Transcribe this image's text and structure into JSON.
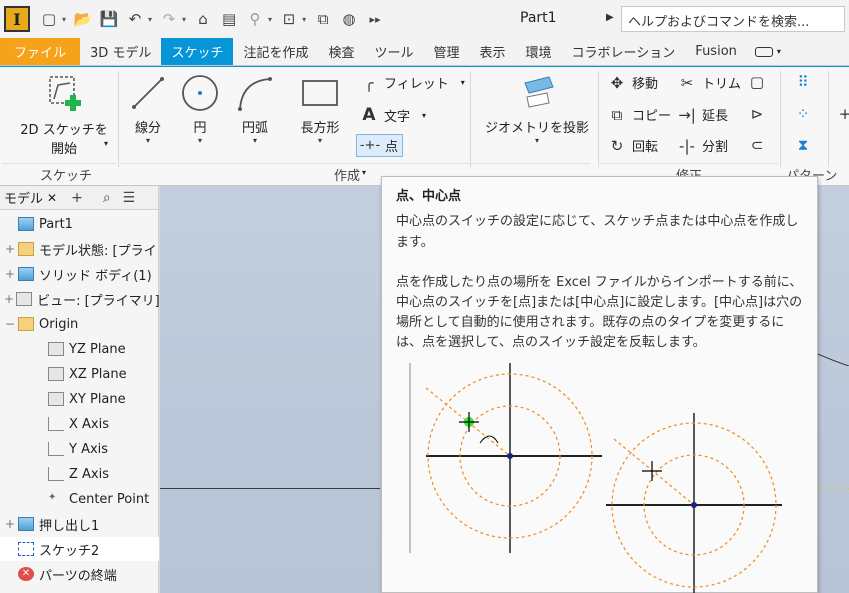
{
  "app": {
    "logo_letter": "I",
    "document_title": "Part1"
  },
  "help_search": {
    "placeholder": "ヘルプおよびコマンドを検索..."
  },
  "tabs": [
    {
      "label": "ファイル",
      "state": "file"
    },
    {
      "label": "3D モデル",
      "state": "normal"
    },
    {
      "label": "スケッチ",
      "state": "active"
    },
    {
      "label": "注記を作成",
      "state": "normal"
    },
    {
      "label": "検査",
      "state": "normal"
    },
    {
      "label": "ツール",
      "state": "normal"
    },
    {
      "label": "管理",
      "state": "normal"
    },
    {
      "label": "表示",
      "state": "normal"
    },
    {
      "label": "環境",
      "state": "normal"
    },
    {
      "label": "コラボレーション",
      "state": "normal"
    },
    {
      "label": "Fusion",
      "state": "normal"
    }
  ],
  "ribbon": {
    "start_sketch": {
      "line1": "2D スケッチを",
      "line2": "開始"
    },
    "line_label": "線分",
    "circle_label": "円",
    "arc_label": "円弧",
    "rect_label": "長方形",
    "fillet_label": "フィレット",
    "text_label": "文字",
    "point_label": "点",
    "project_geometry_label": "ジオメトリを投影",
    "move_label": "移動",
    "trim_label": "トリム",
    "copy_label": "コピー",
    "extend_label": "延長",
    "rotate_label": "回転",
    "split_label": "分割",
    "panel_sketch": "スケッチ",
    "panel_create": "作成",
    "panel_modify": "修正",
    "panel_pattern": "パターン"
  },
  "browser": {
    "tab_label": "モデル",
    "items": [
      {
        "label": "Part1",
        "icon": "part-icon",
        "indent": 0,
        "expander": ""
      },
      {
        "label": "モデル状態: [プライ",
        "icon": "folder-icon",
        "indent": 1,
        "expander": "+"
      },
      {
        "label": "ソリッド ボディ(1)",
        "icon": "solid-body-icon",
        "indent": 1,
        "expander": "+"
      },
      {
        "label": "ビュー: [プライマリ]",
        "icon": "view-icon",
        "indent": 1,
        "expander": "+"
      },
      {
        "label": "Origin",
        "icon": "folder-open-icon",
        "indent": 1,
        "expander": "−"
      },
      {
        "label": "YZ Plane",
        "icon": "plane-icon",
        "indent": 2,
        "expander": ""
      },
      {
        "label": "XZ Plane",
        "icon": "plane-icon",
        "indent": 2,
        "expander": ""
      },
      {
        "label": "XY Plane",
        "icon": "plane-icon",
        "indent": 2,
        "expander": ""
      },
      {
        "label": "X Axis",
        "icon": "axis-icon",
        "indent": 2,
        "expander": ""
      },
      {
        "label": "Y Axis",
        "icon": "axis-icon",
        "indent": 2,
        "expander": ""
      },
      {
        "label": "Z Axis",
        "icon": "axis-icon",
        "indent": 2,
        "expander": ""
      },
      {
        "label": "Center Point",
        "icon": "center-point-icon",
        "indent": 2,
        "expander": ""
      },
      {
        "label": "押し出し1",
        "icon": "extrude-icon",
        "indent": 1,
        "expander": "+"
      },
      {
        "label": "スケッチ2",
        "icon": "sketch-icon",
        "indent": 1,
        "expander": "",
        "selected": true
      },
      {
        "label": "パーツの終端",
        "icon": "end-of-part-icon",
        "indent": 1,
        "expander": ""
      }
    ]
  },
  "tooltip": {
    "title": "点、中心点",
    "desc1": "中心点のスイッチの設定に応じて、スケッチ点または中心点を作成します。",
    "desc2": "点を作成したり点の場所を Excel ファイルからインポートする前に、中心点のスイッチを[点]または[中心点]に設定します。[中心点]は穴の場所として自動的に使用されます。既存の点のタイプを変更するには、点を選択して、点のスイッチ設定を反転します。"
  },
  "colors": {
    "accent_blue": "#0696d7",
    "file_orange": "#f7a21b",
    "tooltip_circle_orange": "#f08a1c",
    "point_green": "#2ee82e",
    "center_navy": "#1a237e"
  }
}
